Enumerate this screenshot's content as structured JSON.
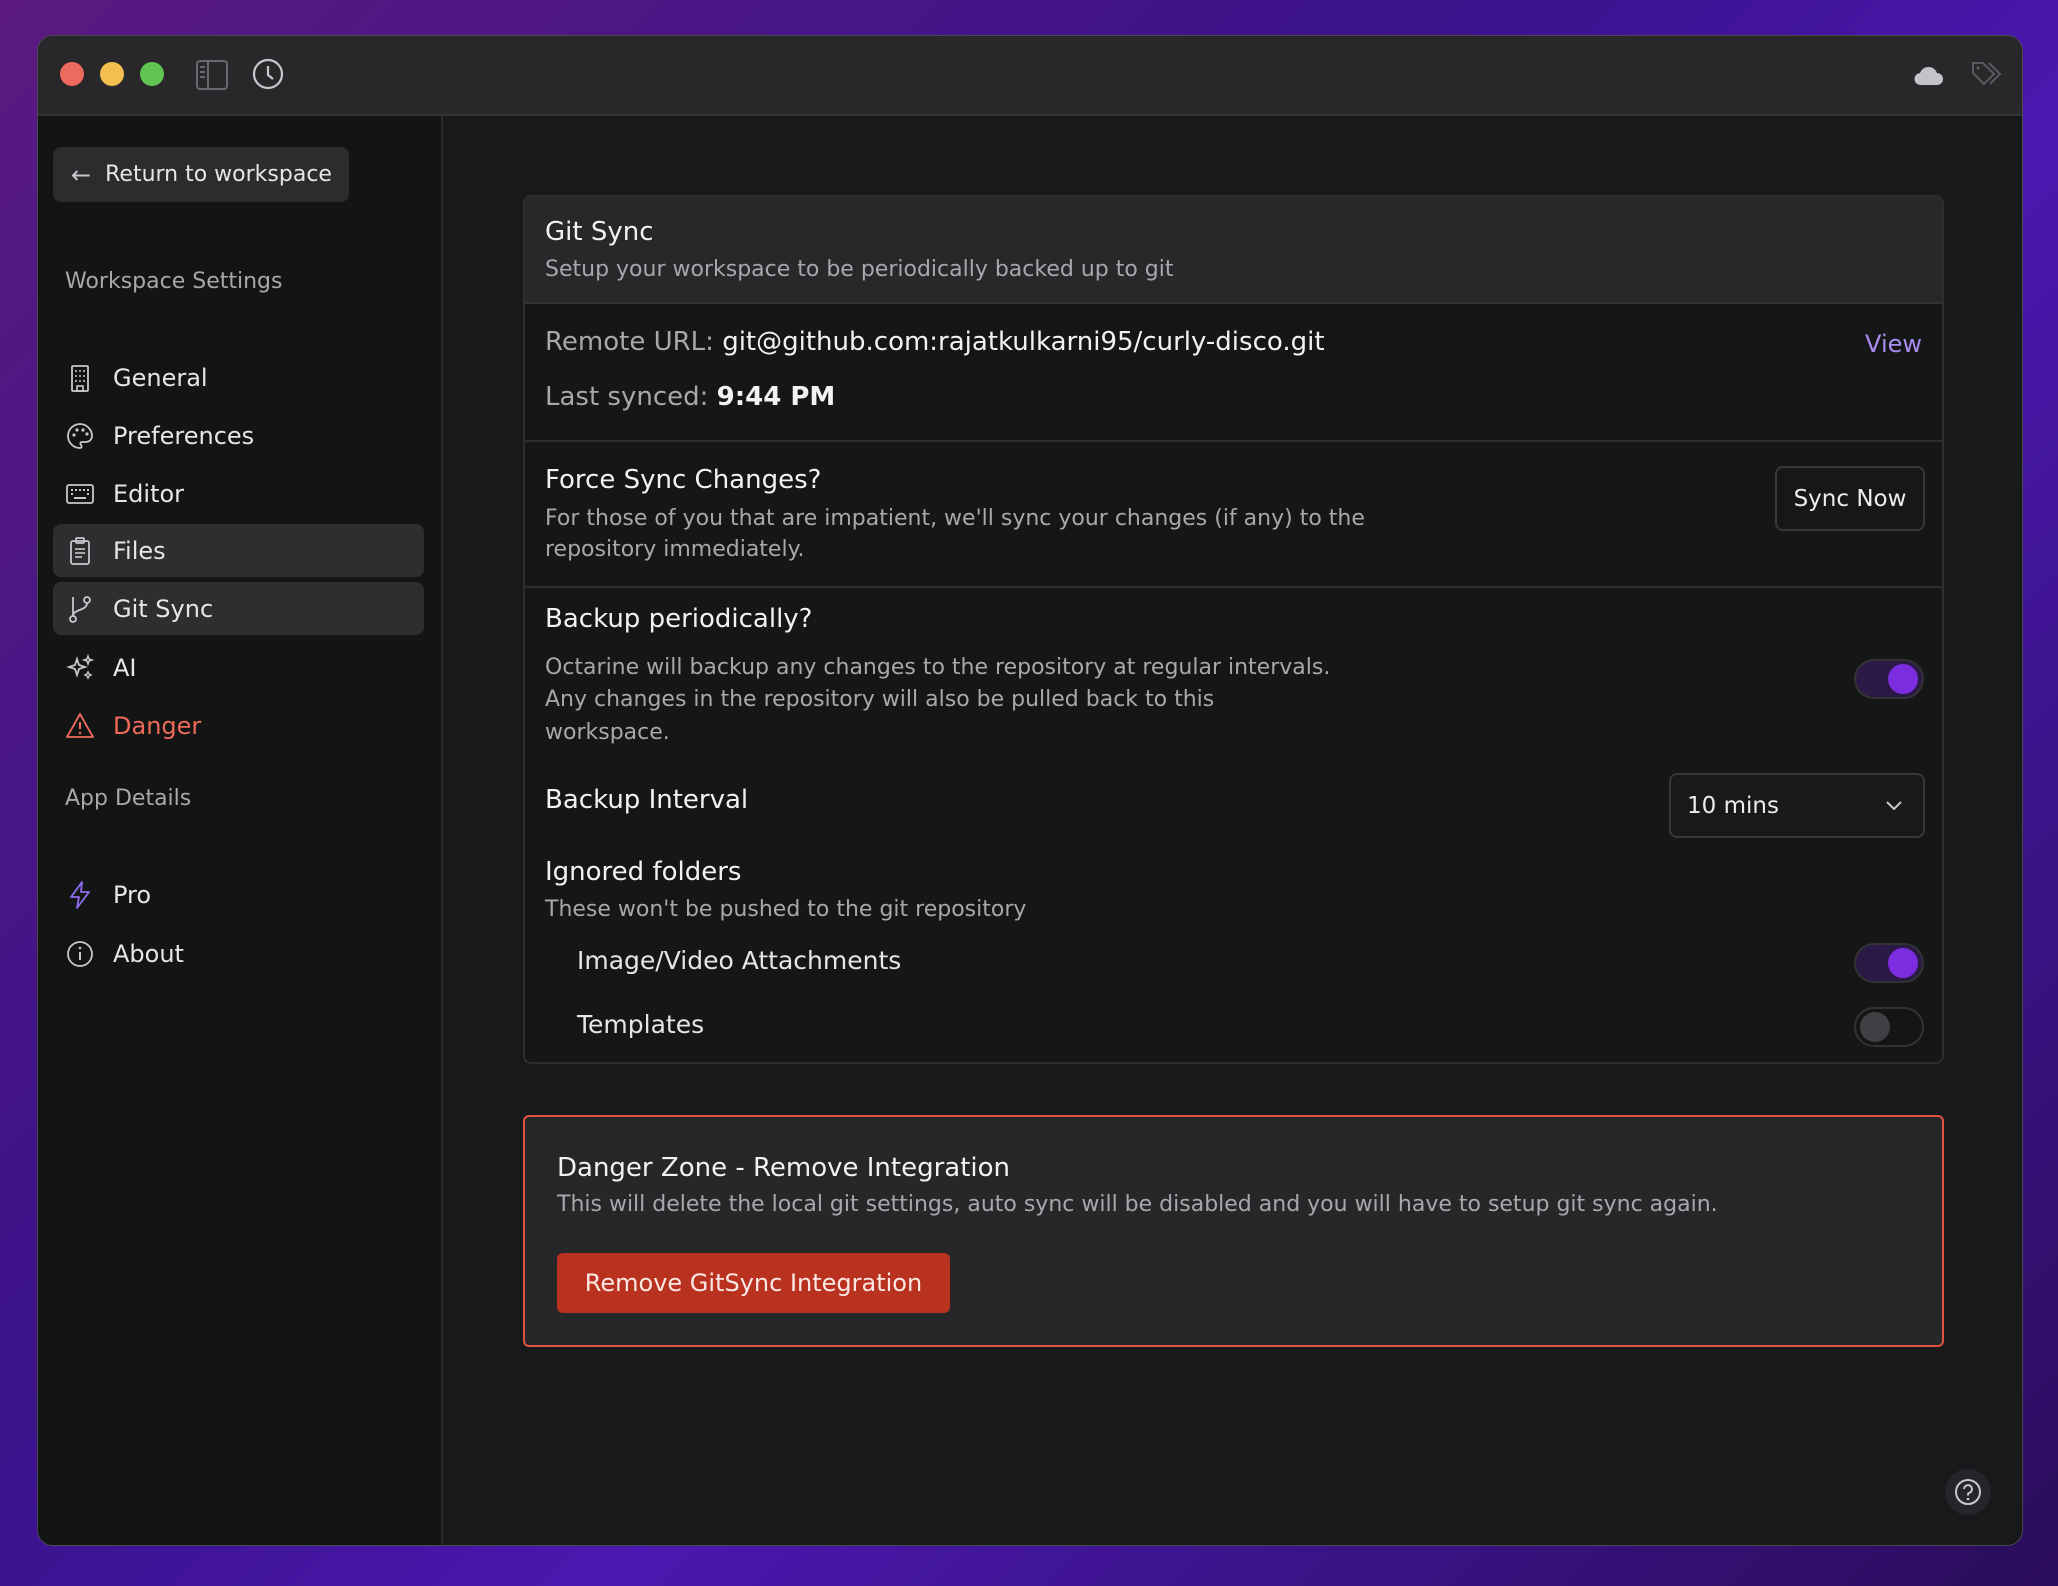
{
  "titlebar": {
    "icons": [
      "sidebar-toggle-icon",
      "history-clock-icon",
      "cloud-icon",
      "tags-icon"
    ]
  },
  "sidebar": {
    "return_label": "Return to workspace",
    "workspace_heading": "Workspace Settings",
    "items": [
      {
        "label": "General",
        "icon": "building-icon"
      },
      {
        "label": "Preferences",
        "icon": "palette-icon"
      },
      {
        "label": "Editor",
        "icon": "keyboard-icon"
      },
      {
        "label": "Files",
        "icon": "clipboard-icon"
      },
      {
        "label": "Git Sync",
        "icon": "git-branch-icon"
      },
      {
        "label": "AI",
        "icon": "sparkles-icon"
      },
      {
        "label": "Danger",
        "icon": "warning-icon"
      }
    ],
    "app_heading": "App Details",
    "app_items": [
      {
        "label": "Pro",
        "icon": "bolt-icon"
      },
      {
        "label": "About",
        "icon": "info-icon"
      }
    ]
  },
  "gitsync": {
    "title": "Git Sync",
    "subtitle": "Setup your workspace to be periodically backed up to git",
    "remote_label": "Remote URL:",
    "remote_value": "git@github.com:rajatkulkarni95/curly-disco.git",
    "view_label": "View",
    "last_synced_label": "Last synced:",
    "last_synced_value": "9:44 PM",
    "force_title": "Force Sync Changes?",
    "force_desc1": "For those of you that are impatient, we'll sync your changes (if any) to the",
    "force_desc2": "repository immediately.",
    "sync_now": "Sync Now",
    "backup_title": "Backup periodically?",
    "backup_desc1": "Octarine will backup any changes to the repository at regular intervals.",
    "backup_desc2": "Any changes in the repository will also be pulled back to this",
    "backup_desc3": "workspace.",
    "backup_enabled": true,
    "interval_label": "Backup Interval",
    "interval_value": "10 mins",
    "ignored_title": "Ignored folders",
    "ignored_desc": "These won't be pushed to the git repository",
    "ignored": [
      {
        "label": "Image/Video Attachments",
        "enabled": true
      },
      {
        "label": "Templates",
        "enabled": false
      }
    ]
  },
  "danger": {
    "title": "Danger Zone - Remove Integration",
    "desc": "This will delete the local git settings, auto sync will be disabled and you will have to setup git sync again.",
    "button": "Remove GitSync Integration"
  },
  "colors": {
    "accent": "#7b2ddf",
    "link": "#a98cf0",
    "danger": "#e0533f",
    "danger_button": "#b8321f"
  }
}
